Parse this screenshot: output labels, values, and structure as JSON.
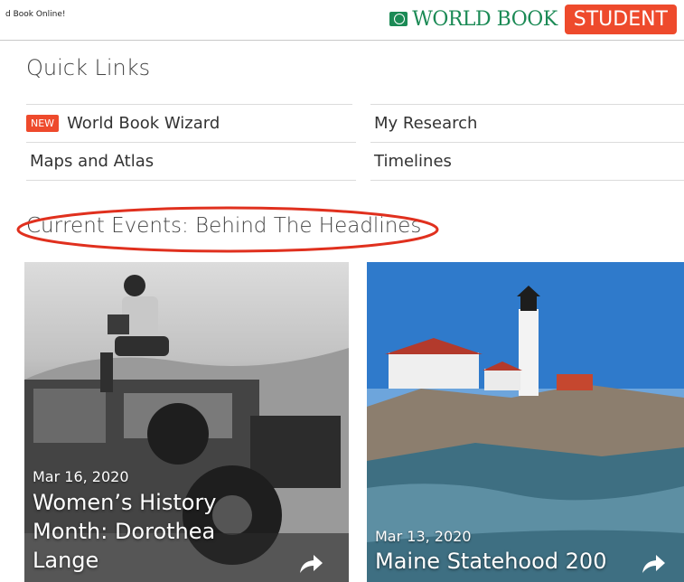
{
  "header": {
    "breadcrumb": "d Book Online!",
    "logo_text": "WORLD BOOK",
    "logo_badge": "STUDENT",
    "brand_green": "#1b8a55",
    "brand_orange": "#ee4a2c"
  },
  "quick_links": {
    "heading": "Quick Links",
    "items": [
      {
        "label": "World Book Wizard",
        "badge": "NEW"
      },
      {
        "label": "My Research"
      },
      {
        "label": "Maps and Atlas"
      },
      {
        "label": "Timelines"
      }
    ]
  },
  "current_events": {
    "heading": "Current Events: Behind The Headlines",
    "highlight_color": "#e0301e",
    "cards": [
      {
        "date": "Mar 16, 2020",
        "title": "Women’s History Month: Dorothea Lange",
        "icon": "share-arrow-icon"
      },
      {
        "date": "Mar 13, 2020",
        "title": "Maine Statehood 200",
        "icon": "share-arrow-icon"
      }
    ]
  }
}
